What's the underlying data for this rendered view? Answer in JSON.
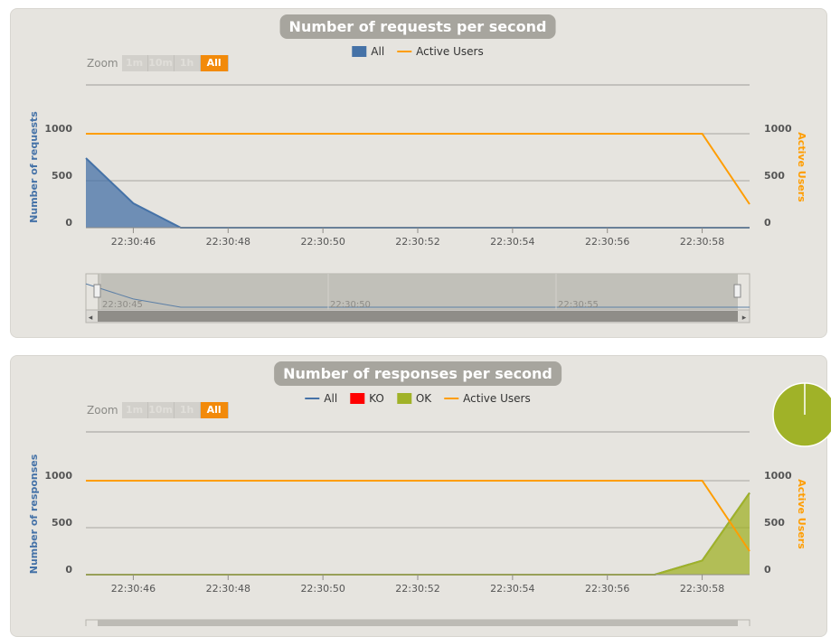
{
  "colors": {
    "all": "#4572a7",
    "ko": "#ff0000",
    "ok": "#a0b228",
    "active_users": "#ff9d00",
    "zoom_active": "#f28a0a"
  },
  "zoom": {
    "label": "Zoom",
    "buttons": [
      "1m",
      "10m",
      "1h",
      "All"
    ],
    "active": "All"
  },
  "chart_data": [
    {
      "type": "area",
      "title": "Number of requests per second",
      "ylabel": "Number of requests",
      "ylabel2": "Active Users",
      "x_ticks": [
        "22:30:46",
        "22:30:48",
        "22:30:50",
        "22:30:52",
        "22:30:54",
        "22:30:56",
        "22:30:58"
      ],
      "y_ticks": [
        0,
        500,
        1000
      ],
      "y2_ticks": [
        0,
        500,
        1000
      ],
      "x_seconds": [
        45,
        46,
        47,
        48,
        49,
        50,
        51,
        52,
        53,
        54,
        55,
        56,
        57,
        58,
        59
      ],
      "series": [
        {
          "name": "All",
          "kind": "area",
          "axis": "left",
          "values": [
            740,
            260,
            0,
            0,
            0,
            0,
            0,
            0,
            0,
            0,
            0,
            0,
            0,
            0,
            0
          ]
        },
        {
          "name": "Active Users",
          "kind": "line",
          "axis": "right",
          "values": [
            1000,
            1000,
            1000,
            1000,
            1000,
            1000,
            1000,
            1000,
            1000,
            1000,
            1000,
            1000,
            1000,
            1000,
            250
          ]
        }
      ],
      "navigator": {
        "labels": [
          "22:30:45",
          "22:30:50",
          "22:30:55"
        ]
      }
    },
    {
      "type": "area",
      "title": "Number of responses per second",
      "ylabel": "Number of responses",
      "ylabel2": "Active Users",
      "x_ticks": [
        "22:30:46",
        "22:30:48",
        "22:30:50",
        "22:30:52",
        "22:30:54",
        "22:30:56",
        "22:30:58"
      ],
      "y_ticks": [
        0,
        500,
        1000
      ],
      "y2_ticks": [
        0,
        500,
        1000
      ],
      "x_seconds": [
        45,
        46,
        47,
        48,
        49,
        50,
        51,
        52,
        53,
        54,
        55,
        56,
        57,
        58,
        59
      ],
      "series": [
        {
          "name": "All",
          "kind": "line",
          "axis": "left",
          "values": [
            0,
            0,
            0,
            0,
            0,
            0,
            0,
            0,
            0,
            0,
            0,
            0,
            0,
            150,
            870
          ]
        },
        {
          "name": "KO",
          "kind": "area",
          "axis": "left",
          "values": [
            0,
            0,
            0,
            0,
            0,
            0,
            0,
            0,
            0,
            0,
            0,
            0,
            0,
            0,
            0
          ]
        },
        {
          "name": "OK",
          "kind": "area",
          "axis": "left",
          "values": [
            0,
            0,
            0,
            0,
            0,
            0,
            0,
            0,
            0,
            0,
            0,
            0,
            0,
            150,
            870
          ]
        },
        {
          "name": "Active Users",
          "kind": "line",
          "axis": "right",
          "values": [
            1000,
            1000,
            1000,
            1000,
            1000,
            1000,
            1000,
            1000,
            1000,
            1000,
            1000,
            1000,
            1000,
            1000,
            250
          ]
        }
      ],
      "pie": {
        "ok": 100,
        "ko": 0
      }
    }
  ]
}
